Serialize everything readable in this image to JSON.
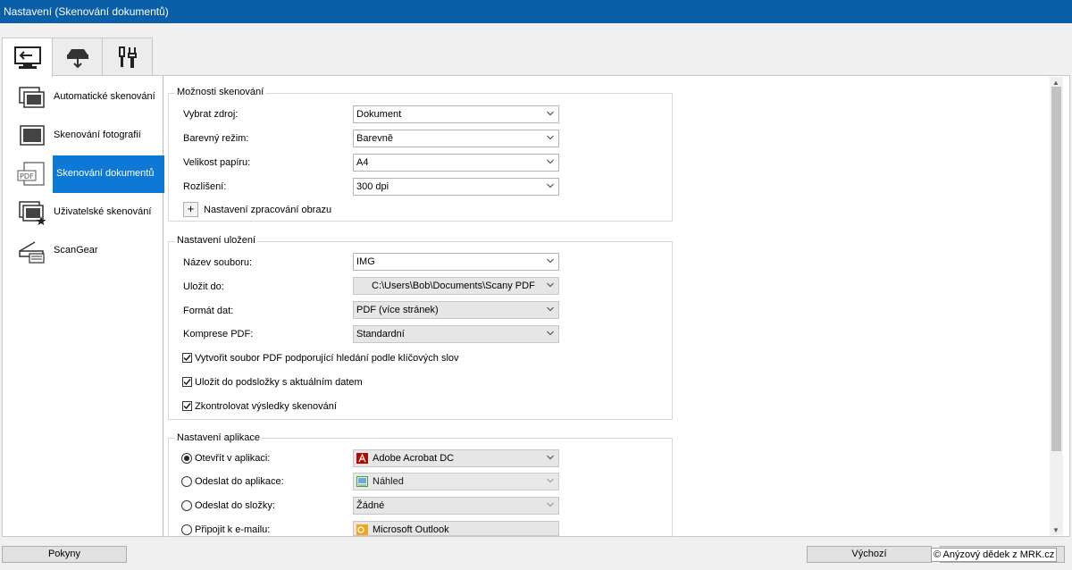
{
  "window": {
    "title": "Nastavení (Skenování dokumentů)"
  },
  "tabs": [
    {
      "icon": "scan-from-computer-icon",
      "active": true
    },
    {
      "icon": "scan-from-panel-icon",
      "active": false
    },
    {
      "icon": "general-settings-tools-icon",
      "active": false
    }
  ],
  "sidebar": {
    "items": [
      {
        "label": "Automatické skenování",
        "icon": "auto-scan-icon"
      },
      {
        "label": "Skenování fotografií",
        "icon": "photo-scan-icon"
      },
      {
        "label": "Skenování dokumentů",
        "icon": "pdf-document-icon",
        "selected": true
      },
      {
        "label": "Uživatelské skenování",
        "icon": "custom-scan-icon"
      },
      {
        "label": "ScanGear",
        "icon": "scangear-icon"
      }
    ]
  },
  "scan_options": {
    "title": "Možnosti skenování",
    "source": {
      "label": "Vybrat zdroj:",
      "value": "Dokument"
    },
    "color_mode": {
      "label": "Barevný režim:",
      "value": "Barevně"
    },
    "paper_size": {
      "label": "Velikost papíru:",
      "value": "A4"
    },
    "resolution": {
      "label": "Rozlišení:",
      "value": "300 dpi"
    },
    "image_processing": {
      "label": "Nastavení zpracování obrazu",
      "button": "+"
    }
  },
  "save_settings": {
    "title": "Nastavení uložení",
    "file_name": {
      "label": "Název souboru:",
      "value": "IMG"
    },
    "save_to": {
      "label": "Uložit do:",
      "value": "C:\\Users\\Bob\\Documents\\Scany PDF"
    },
    "data_format": {
      "label": "Formát dat:",
      "value": "PDF (více stránek)"
    },
    "pdf_compression": {
      "label": "Komprese PDF:",
      "value": "Standardní"
    },
    "checkboxes": [
      {
        "label": "Vytvořit soubor PDF podporující hledání podle klíčových slov",
        "checked": true
      },
      {
        "label": "Uložit do podsložky s aktuálním datem",
        "checked": true
      },
      {
        "label": "Zkontrolovat výsledky skenování",
        "checked": true
      }
    ]
  },
  "app_settings": {
    "title": "Nastavení aplikace",
    "options": [
      {
        "label": "Otevřít v aplikaci:",
        "value": "Adobe Acrobat DC",
        "selected": true,
        "icon": "acrobat-icon"
      },
      {
        "label": "Odeslat do aplikace:",
        "value": "Náhled",
        "selected": false,
        "icon": "preview-app-icon"
      },
      {
        "label": "Odeslat do složky:",
        "value": "Žádné",
        "selected": false,
        "icon": ""
      },
      {
        "label": "Připojit k e-mailu:",
        "value": "Microsoft Outlook",
        "selected": false,
        "icon": "outlook-icon"
      }
    ]
  },
  "footer": {
    "instructions_button": "Pokyny",
    "defaults_button": "Výchozí",
    "watermark": "© Anýzový dědek z MRK.cz"
  },
  "colors": {
    "titlebar": "#0b5fa9",
    "selection": "#0e78d7",
    "window_bg": "#f0f0f0"
  }
}
